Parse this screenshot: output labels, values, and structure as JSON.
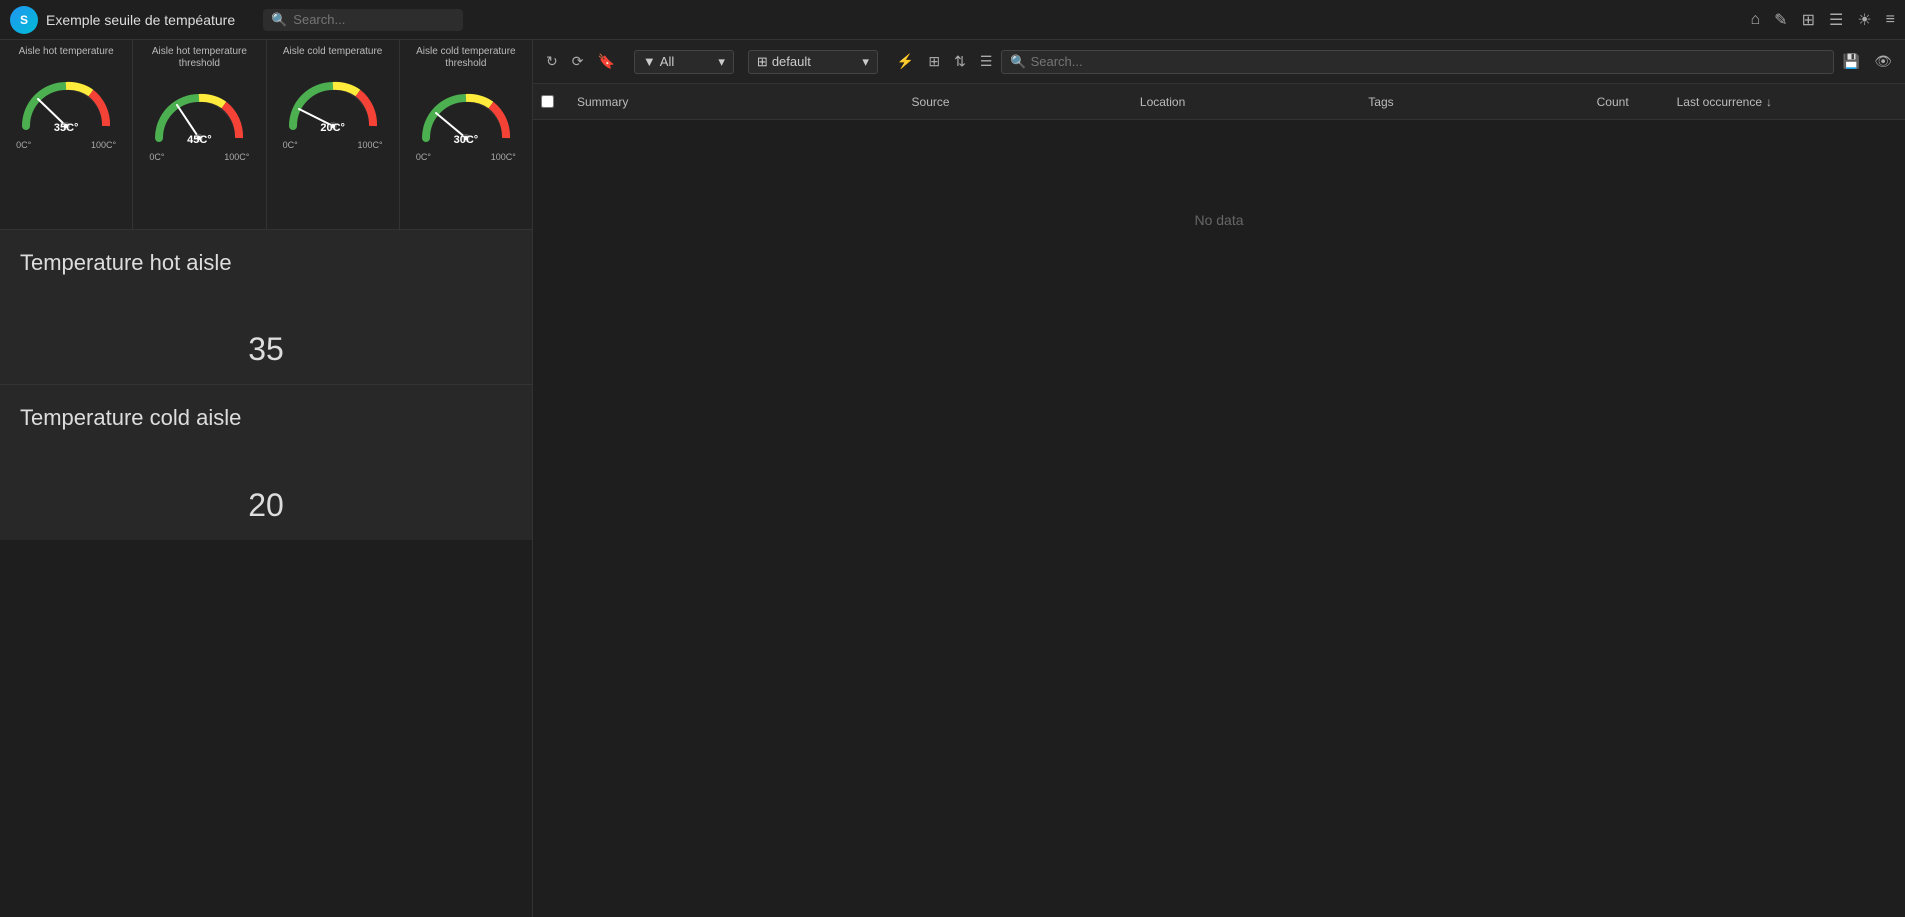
{
  "app": {
    "logo_text": "S",
    "title": "Exemple seuile de tempéature"
  },
  "topbar": {
    "search_placeholder": "Search...",
    "icons": [
      "home",
      "edit",
      "dashboard",
      "list",
      "brightness",
      "menu"
    ]
  },
  "gauges": [
    {
      "title": "Aisle hot temperature",
      "value": 35,
      "value_label": "35C°",
      "min_label": "0C°",
      "max_label": "100C°",
      "needle_angle": -65,
      "color": "green-yellow"
    },
    {
      "title": "Aisle hot temperature threshold",
      "value": 45,
      "value_label": "45C°",
      "min_label": "0C°",
      "max_label": "100C°",
      "needle_angle": -45,
      "color": "yellow-red"
    },
    {
      "title": "Aisle cold temperature",
      "value": 20,
      "value_label": "20C°",
      "min_label": "0C°",
      "max_label": "100C°",
      "needle_angle": -90,
      "color": "green"
    },
    {
      "title": "Aisle cold temperature threshold",
      "value": 30,
      "value_label": "30C°",
      "min_label": "0C°",
      "max_label": "100C°",
      "needle_angle": -75,
      "color": "green-yellow"
    }
  ],
  "hot_aisle": {
    "title": "Temperature hot aisle",
    "value": "35"
  },
  "cold_aisle": {
    "title": "Temperature cold aisle",
    "value": "20"
  },
  "alerts": {
    "toolbar": {
      "filter_label": "All",
      "profile_label": "default",
      "search_placeholder": "Search...",
      "save_label": "Save"
    },
    "table": {
      "columns": [
        "Summary",
        "Source",
        "Location",
        "Tags",
        "Count",
        "Last occurrence"
      ],
      "no_data": "No data"
    }
  }
}
